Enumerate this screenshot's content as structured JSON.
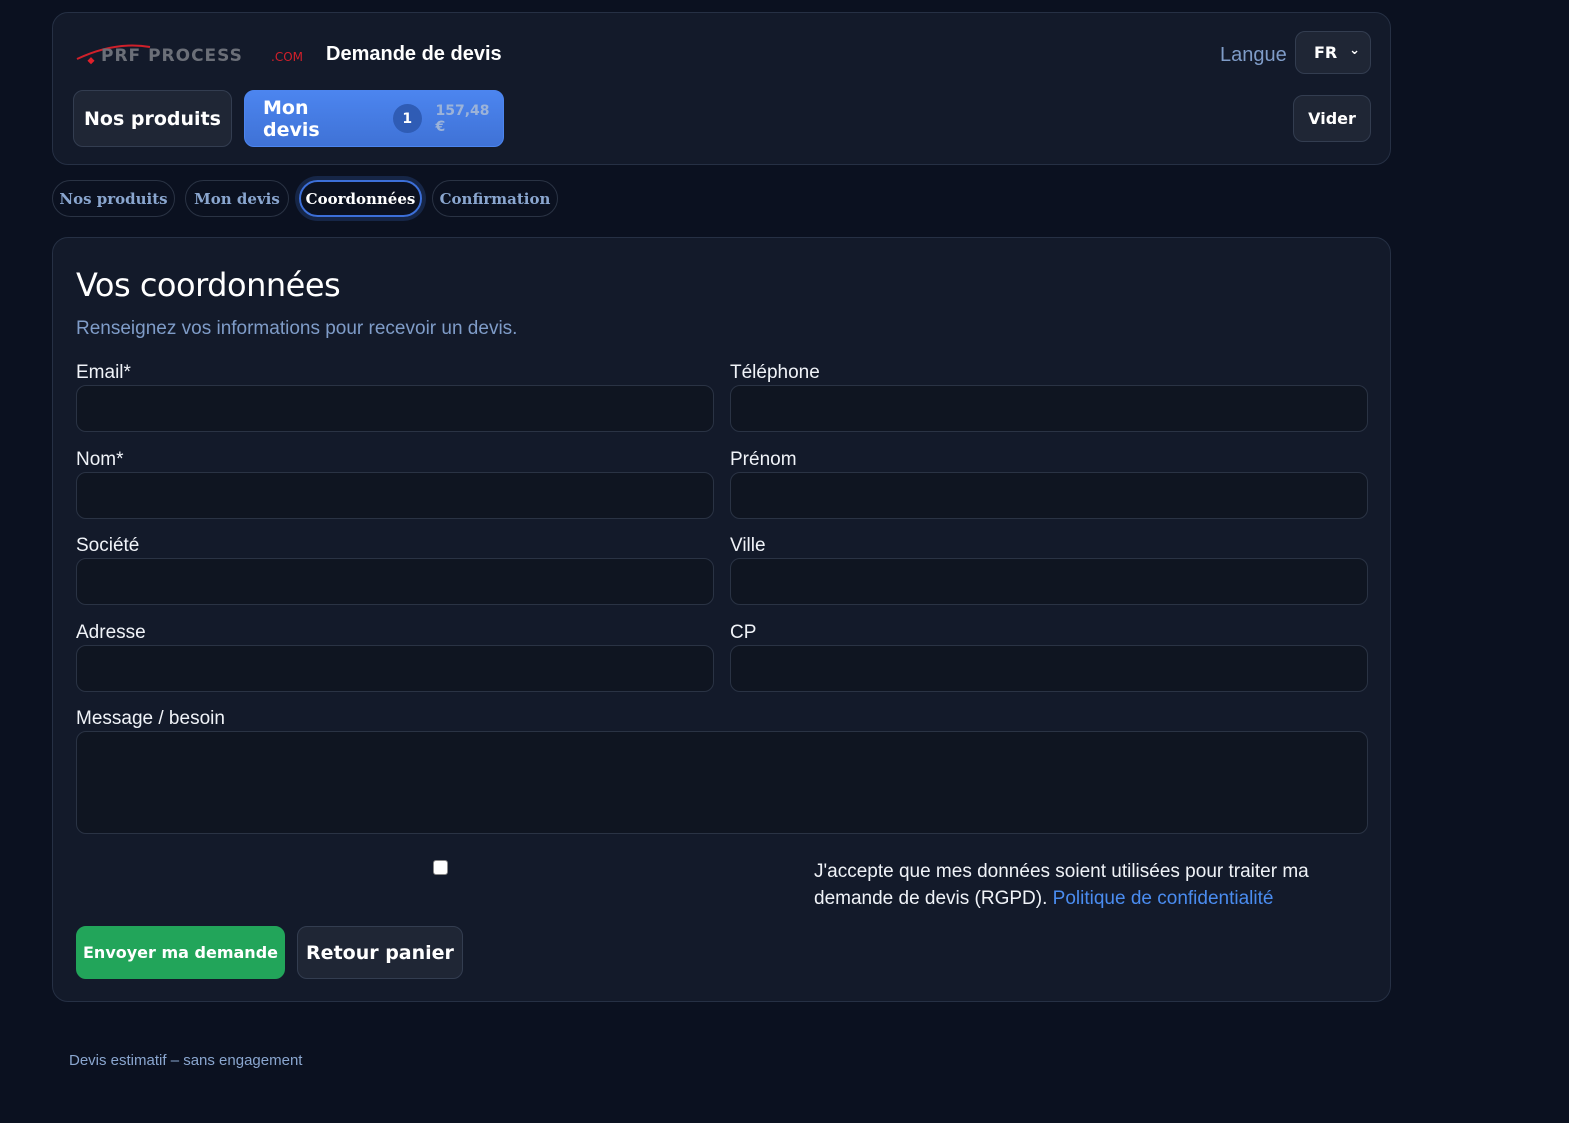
{
  "header": {
    "logo_text": "PRF PROCESS.com",
    "title": "Demande de devis",
    "lang_label": "Langue",
    "lang_value": "FR",
    "products_button": "Nos produits",
    "quote_button": "Mon devis",
    "quote_count": "1",
    "quote_total": "157,48 €",
    "clear_button": "Vider",
    "accent": "#4a80ea"
  },
  "steps": [
    {
      "label": "Nos produits"
    },
    {
      "label": "Mon devis"
    },
    {
      "label": "Coordonnées",
      "active": true
    },
    {
      "label": "Confirmation"
    }
  ],
  "form": {
    "title": "Vos coordonnées",
    "subtitle": "Renseignez vos informations pour recevoir un devis.",
    "fields": [
      {
        "label": "Email*",
        "value": ""
      },
      {
        "label": "Téléphone",
        "value": ""
      },
      {
        "label": "Nom*",
        "value": ""
      },
      {
        "label": "Prénom",
        "value": ""
      },
      {
        "label": "Société",
        "value": ""
      },
      {
        "label": "Ville",
        "value": ""
      },
      {
        "label": "Adresse",
        "value": ""
      },
      {
        "label": "CP",
        "value": ""
      }
    ],
    "message_label": "Message / besoin",
    "consent_text": "J'accepte que mes données soient utilisées pour traiter ma demande de devis (RGPD).",
    "consent_link": "Politique de confidentialité",
    "consent_checked": false,
    "submit_button": "Envoyer ma demande",
    "back_button": "Retour panier",
    "submit_color": "#22a55a"
  },
  "footer": {
    "text": "Devis estimatif – sans engagement"
  }
}
